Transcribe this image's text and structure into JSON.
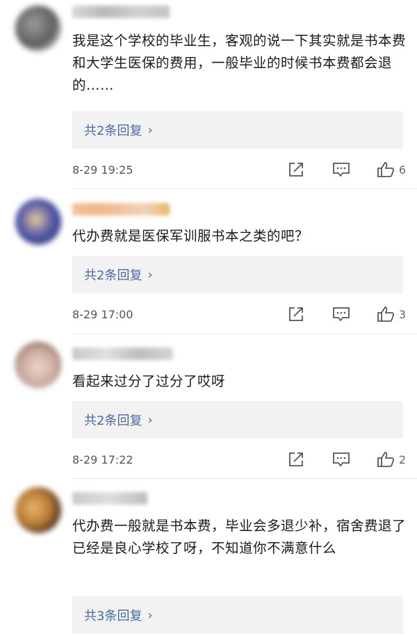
{
  "comments": [
    {
      "text": "我是这个学校的毕业生，客观的说一下其实就是书本费和大学生医保的费用，一般毕业的时候书本费都会退的……",
      "reply_label": "共2条回复",
      "time": "8-29 19:25",
      "likes": "6"
    },
    {
      "text": "代办费就是医保军训服书本之类的吧？",
      "reply_label": "共2条回复",
      "time": "8-29 17:00",
      "likes": "3"
    },
    {
      "text": "看起来过分了过分了哎呀",
      "reply_label": "共2条回复",
      "time": "8-29 17:22",
      "likes": "2"
    },
    {
      "text": "代办费一般就是书本费，毕业会多退少补，宿舍费退了已经是良心学校了呀，不知道你不满意什么",
      "reply_label": "共3条回复"
    }
  ],
  "icons": {
    "share": "share-icon",
    "comment": "comment-icon",
    "like": "thumbs-up-icon",
    "chevron": "chevron-right-icon"
  },
  "colors": {
    "link": "#4a6a9c",
    "reply_bg": "#f2f2f2",
    "icon": "#555555"
  }
}
